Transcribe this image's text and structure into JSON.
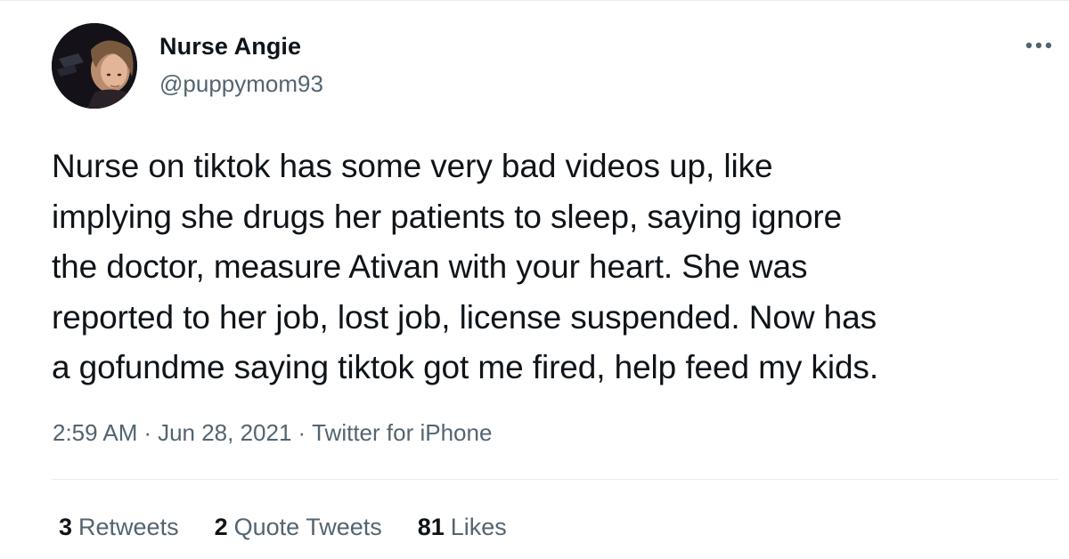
{
  "author": {
    "display_name": "Nurse Angie",
    "handle": "@puppymom93",
    "avatar_icon": "profile-photo"
  },
  "tweet": {
    "text": "Nurse on tiktok has some very bad videos up, like\nimplying she drugs her patients to sleep, saying ignore\nthe doctor, measure Ativan with your heart. She was\nreported to her job, lost job, license suspended. Now has\na gofundme saying tiktok got me fired, help feed my kids."
  },
  "meta": {
    "time": "2:59 AM",
    "separator": "·",
    "date": "Jun 28, 2021",
    "source": "Twitter for iPhone"
  },
  "stats": {
    "retweets": {
      "count": "3",
      "label": "Retweets"
    },
    "quote_tweets": {
      "count": "2",
      "label": "Quote Tweets"
    },
    "likes": {
      "count": "81",
      "label": "Likes"
    }
  },
  "icons": {
    "more": "more-horizontal-icon"
  },
  "colors": {
    "primary_text": "#0f1419",
    "secondary_text": "#536471",
    "divider": "#e6ecf0"
  }
}
